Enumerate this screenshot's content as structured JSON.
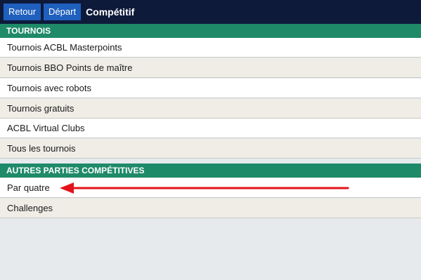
{
  "topbar": {
    "back_label": "Retour",
    "home_label": "Départ",
    "title": "Compétitif"
  },
  "sections": [
    {
      "header": "TOURNOIS",
      "items": [
        "Tournois ACBL Masterpoints",
        "Tournois BBO Points de maître",
        "Tournois avec robots",
        "Tournois gratuits",
        "ACBL Virtual Clubs",
        "Tous les tournois"
      ]
    },
    {
      "header": "AUTRES PARTIES COMPÉTITIVES",
      "items": [
        "Par quatre",
        "Challenges"
      ]
    }
  ],
  "colors": {
    "topbar_bg": "#0e1a3a",
    "nav_button_bg": "#1f5fbd",
    "section_header_bg": "#1f8a68",
    "annotation_arrow": "#e3131b"
  }
}
